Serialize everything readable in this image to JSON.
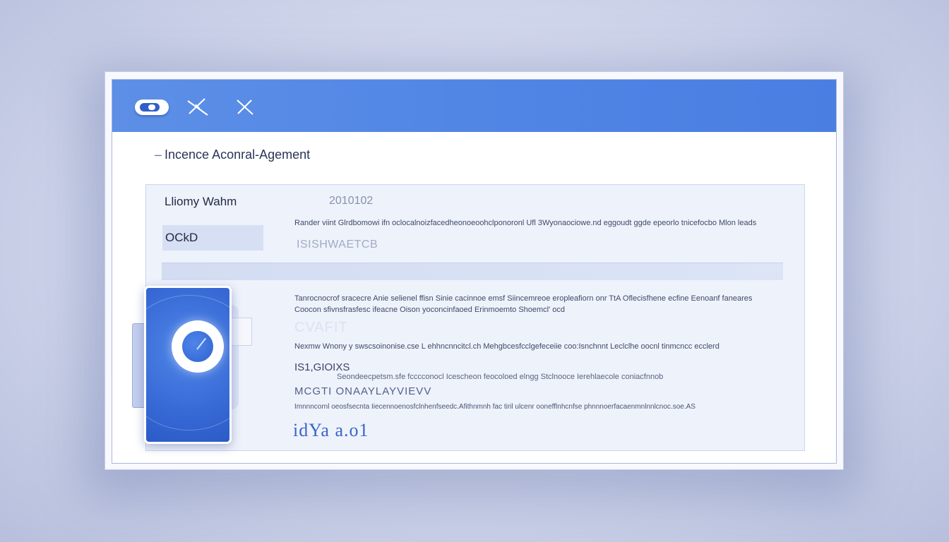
{
  "window": {
    "title": "Incence Aconral-Agement",
    "title_prefix": "–"
  },
  "toolbar": {
    "icons": [
      "toggle-icon",
      "close-icon",
      "close-icon"
    ]
  },
  "form": {
    "name_label": "Lliomy Wahm",
    "date_value": "2010102",
    "ok_button": "OCkD",
    "paragraph_1": "Rander viint Glrdbomowi ifn oclocalnoizfacedheonoeoohclponoronl Ufl 3Wyonaociowe.nd eggoudt ggde epeorlo tnicefocbo Mlon leads",
    "status_text": "ISISHWAETCB",
    "paragraph_2a": "Tanrocnocrof sracecre Anie selienel ffisn Sinie cacinnoe emsf Siincemreoe eropleafiorn onr TtA Oflecisfhene ecfine Eenoanf faneares",
    "paragraph_2b": "Coocon sfivnsfrasfesc ifeacne Oison yoconcinfaoed Erinmoemto Shoemcl' ocd",
    "faded_text": "CVAFIT",
    "paragraph_3": "Nexmw Wnony  y swscsoinonise.cse L ehhncnncitcl.ch Mehgbcesfcclgefeceiie coo:Isnchnnt Leclclhe oocnl tinmcncc  ecclerd",
    "code_1": "IS1,GIOIXS",
    "paragraph_4": "Seondeecpetsm.sfe fcccconocl Icescheon feocoloed elngg Stclnooce Ierehlaecole coniacfnnob",
    "code_2": "MCGTI  ONAAYLAYVIEVV",
    "paragraph_5": "Imnnncornl oeosfsecnta Iiecennoenosfclnhenfseedc.Afithnmnh fac tiril ulcenr oonefflnhcnfse phnnnoerfacaenmnlnnlcnoc.soe.AS",
    "signature": "idYa a.o1"
  },
  "colors": {
    "titlebar": "#5388e5",
    "accent": "#3a65c9",
    "panel": "#eef2fb"
  }
}
